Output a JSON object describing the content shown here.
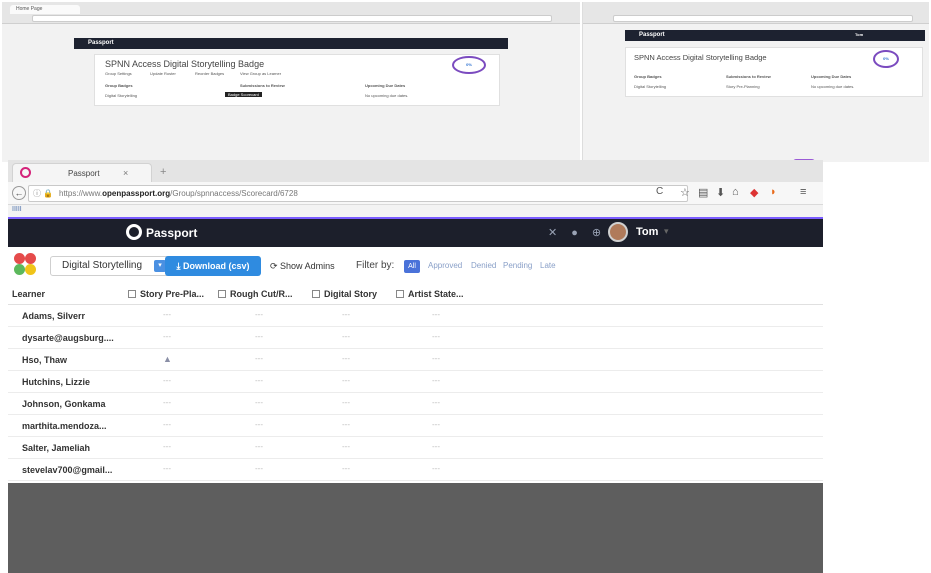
{
  "thumb_left": {
    "tab_title": "Home Page",
    "nav_label": "Passport",
    "card_title": "SPNN Access Digital Storytelling Badge",
    "sub_links": [
      "Group Settings",
      "Update Roster",
      "Reorder Badges",
      "Print Scorecard",
      "View Group as Learner"
    ],
    "col_group": "Group Badges",
    "col_review": "Submissions to Review",
    "col_due": "Upcoming Due Dates",
    "group_value": "Digital Storytelling",
    "tooltip": "Badge Scorecard",
    "due_text": "No upcoming due dates.",
    "percent": "0%"
  },
  "thumb_right": {
    "nav_label": "Passport",
    "user": "Tom",
    "card_title": "SPNN Access Digital Storytelling Badge",
    "col_group": "Group Badges",
    "col_review": "Submissions to Review",
    "col_due": "Upcoming Due Dates",
    "group_value": "Digital Storytelling",
    "review_value": "Story Pre-Planning",
    "due_text": "No upcoming due dates.",
    "percent": "0%"
  },
  "browser": {
    "tab_title": "Passport",
    "url_prefix": "https://www.",
    "url_domain": "openpassport.org",
    "url_path": "/Group/spnnaccess/Scorecard/6728",
    "bookmark": "IIIII"
  },
  "app": {
    "brand": "Passport",
    "user": "Tom",
    "group_select": "Digital Storytelling",
    "download_label": "Download (csv)",
    "admins_label": "Show Admins",
    "filter_label": "Filter by:",
    "filters": [
      "All",
      "Approved",
      "Denied",
      "Pending",
      "Late"
    ]
  },
  "grid": {
    "headers": [
      "Learner",
      "Story Pre-Pla...",
      "Rough Cut/R...",
      "Digital Story",
      "Artist State..."
    ],
    "rows": [
      {
        "name": "Adams, Silverr",
        "cells": [
          "---",
          "---",
          "---",
          "---"
        ]
      },
      {
        "name": "dysarte@augsburg....",
        "cells": [
          "---",
          "---",
          "---",
          "---"
        ]
      },
      {
        "name": "Hso, Thaw",
        "cells": [
          "▲",
          "---",
          "---",
          "---"
        ]
      },
      {
        "name": "Hutchins, Lizzie",
        "cells": [
          "---",
          "---",
          "---",
          "---"
        ]
      },
      {
        "name": "Johnson, Gonkama",
        "cells": [
          "---",
          "---",
          "---",
          "---"
        ]
      },
      {
        "name": "marthita.mendoza...",
        "cells": [
          "---",
          "---",
          "---",
          "---"
        ]
      },
      {
        "name": "Salter, Jameliah",
        "cells": [
          "---",
          "---",
          "---",
          "---"
        ]
      },
      {
        "name": "stevelav700@gmail...",
        "cells": [
          "---",
          "---",
          "---",
          "---"
        ]
      }
    ]
  },
  "colors": {
    "appbar": "#1c1f2b",
    "accent": "#2f8be0",
    "ring": "#7b4bbf"
  }
}
